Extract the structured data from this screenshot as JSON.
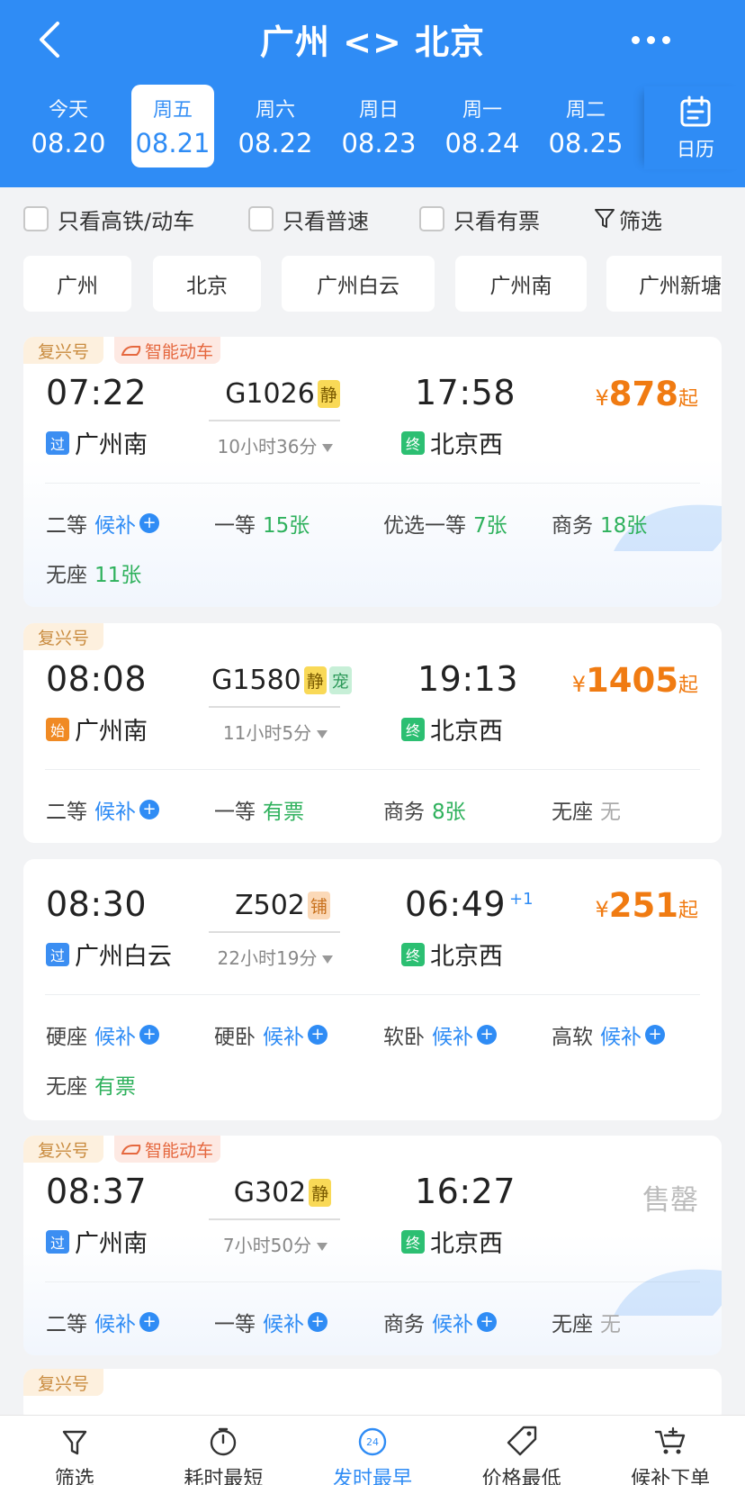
{
  "header": {
    "title": "广州 <> 北京",
    "dates": [
      {
        "weekday": "今天",
        "date": "08.20"
      },
      {
        "weekday": "周五",
        "date": "08.21",
        "active": true
      },
      {
        "weekday": "周六",
        "date": "08.22"
      },
      {
        "weekday": "周日",
        "date": "08.23"
      },
      {
        "weekday": "周一",
        "date": "08.24"
      },
      {
        "weekday": "周二",
        "date": "08.25"
      }
    ],
    "calendar_label": "日历"
  },
  "filters": {
    "options": [
      "只看高铁/动车",
      "只看普速",
      "只看有票"
    ],
    "screen_label": "筛选"
  },
  "stations": [
    "广州",
    "北京",
    "广州白云",
    "广州南",
    "广州新塘"
  ],
  "trains": [
    {
      "tags": [
        "复兴号",
        "智能动车"
      ],
      "dep_time": "07:22",
      "dep_badge": "过",
      "dep_station": "广州南",
      "train_no": "G1026",
      "train_tags": [
        "静"
      ],
      "duration": "10小时36分",
      "arr_time": "17:58",
      "arr_plus": "",
      "arr_badge": "终",
      "arr_station": "北京西",
      "price_symbol": "¥",
      "price": "878",
      "price_suffix": "起",
      "sold_out": "",
      "seats": [
        {
          "cls": "二等",
          "val": "候补",
          "type": "wait"
        },
        {
          "cls": "一等",
          "val": "15张",
          "type": "ok"
        },
        {
          "cls": "优选一等",
          "val": "7张",
          "type": "ok"
        },
        {
          "cls": "商务",
          "val": "18张",
          "type": "ok"
        },
        {
          "cls": "无座",
          "val": "11张",
          "type": "ok"
        }
      ]
    },
    {
      "tags": [
        "复兴号"
      ],
      "dep_time": "08:08",
      "dep_badge": "始",
      "dep_station": "广州南",
      "train_no": "G1580",
      "train_tags": [
        "静",
        "宠"
      ],
      "duration": "11小时5分",
      "arr_time": "19:13",
      "arr_plus": "",
      "arr_badge": "终",
      "arr_station": "北京西",
      "price_symbol": "¥",
      "price": "1405",
      "price_suffix": "起",
      "sold_out": "",
      "seats": [
        {
          "cls": "二等",
          "val": "候补",
          "type": "wait"
        },
        {
          "cls": "一等",
          "val": "有票",
          "type": "ok"
        },
        {
          "cls": "商务",
          "val": "8张",
          "type": "ok"
        },
        {
          "cls": "无座",
          "val": "无",
          "type": "none"
        }
      ]
    },
    {
      "tags": [],
      "dep_time": "08:30",
      "dep_badge": "过",
      "dep_station": "广州白云",
      "train_no": "Z502",
      "train_tags": [
        "铺"
      ],
      "duration": "22小时19分",
      "arr_time": "06:49",
      "arr_plus": "+1",
      "arr_badge": "终",
      "arr_station": "北京西",
      "price_symbol": "¥",
      "price": "251",
      "price_suffix": "起",
      "sold_out": "",
      "seats": [
        {
          "cls": "硬座",
          "val": "候补",
          "type": "wait"
        },
        {
          "cls": "硬卧",
          "val": "候补",
          "type": "wait"
        },
        {
          "cls": "软卧",
          "val": "候补",
          "type": "wait"
        },
        {
          "cls": "高软",
          "val": "候补",
          "type": "wait"
        },
        {
          "cls": "无座",
          "val": "有票",
          "type": "ok"
        }
      ]
    },
    {
      "tags": [
        "复兴号",
        "智能动车"
      ],
      "dep_time": "08:37",
      "dep_badge": "过",
      "dep_station": "广州南",
      "train_no": "G302",
      "train_tags": [
        "静"
      ],
      "duration": "7小时50分",
      "arr_time": "16:27",
      "arr_plus": "",
      "arr_badge": "终",
      "arr_station": "北京西",
      "price_symbol": "",
      "price": "",
      "price_suffix": "",
      "sold_out": "售罄",
      "seats": [
        {
          "cls": "二等",
          "val": "候补",
          "type": "wait"
        },
        {
          "cls": "一等",
          "val": "候补",
          "type": "wait"
        },
        {
          "cls": "商务",
          "val": "候补",
          "type": "wait"
        },
        {
          "cls": "无座",
          "val": "无",
          "type": "none"
        }
      ]
    }
  ],
  "partial_tag": "复兴号",
  "bottom_nav": [
    {
      "label": "筛选",
      "icon": "filter-icon"
    },
    {
      "label": "耗时最短",
      "icon": "timer-icon"
    },
    {
      "label": "发时最早",
      "icon": "clock-24-icon",
      "active": true
    },
    {
      "label": "价格最低",
      "icon": "price-tag-icon"
    },
    {
      "label": "候补下单",
      "icon": "cart-plus-icon"
    }
  ],
  "colors": {
    "primary": "#2f8cf5",
    "price": "#f07b12",
    "available": "#2eb15c"
  }
}
